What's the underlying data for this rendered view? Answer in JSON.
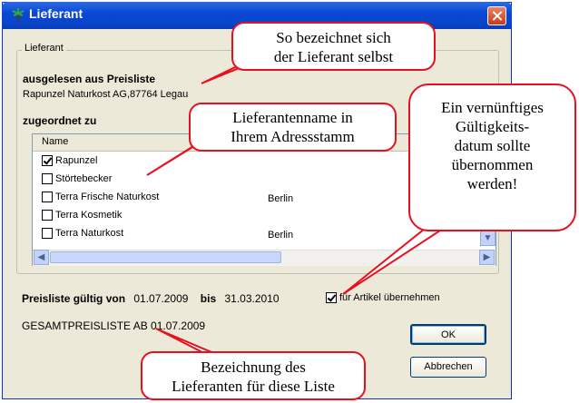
{
  "window": {
    "title": "Lieferant"
  },
  "group": {
    "label": "Lieferant",
    "read_heading": "ausgelesen aus Preisliste",
    "read_value": "Rapunzel Naturkost AG,87764 Legau",
    "assigned_heading": "zugeordnet zu"
  },
  "list": {
    "column_name": "Name",
    "rows": [
      {
        "name": "Rapunzel",
        "city": "",
        "checked": true
      },
      {
        "name": "Störtebecker",
        "city": "",
        "checked": false
      },
      {
        "name": "Terra Frische Naturkost",
        "city": "Berlin",
        "checked": false
      },
      {
        "name": "Terra Kosmetik",
        "city": "",
        "checked": false
      },
      {
        "name": "Terra Naturkost",
        "city": "Berlin",
        "checked": false
      }
    ]
  },
  "validity": {
    "label_from": "Preisliste gültig von",
    "date_from": "01.07.2009",
    "label_to": "bis",
    "date_to": "31.03.2010",
    "apply_checkbox_label": "für Artikel übernehmen"
  },
  "pricelist_name": "GESAMTPREISLISTE AB 01.07.2009",
  "buttons": {
    "ok": "OK",
    "cancel": "Abbrechen"
  },
  "callouts": {
    "supplier_self": [
      "So bezeichnet sich",
      "der Lieferant selbst"
    ],
    "supplier_name": [
      "Lieferantenname in",
      "Ihrem Adressstamm"
    ],
    "validity_hint": [
      "Ein vernünftiges",
      "Gültigkeits-",
      "datum sollte",
      "übernommen",
      "werden!"
    ],
    "list_name": [
      "Bezeichnung des",
      "Lieferanten für diese Liste"
    ]
  },
  "colors": {
    "accent_red": "#e8101e",
    "titlebar_blue": "#0a47d6"
  }
}
